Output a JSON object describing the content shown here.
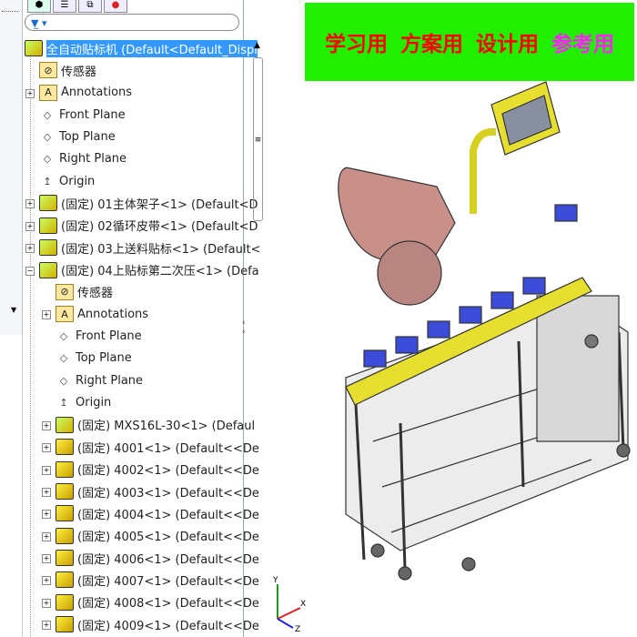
{
  "tabs": [
    "feature-manager",
    "property-manager",
    "configuration-manager",
    "display-manager"
  ],
  "filter": {
    "icon": "funnel-icon ▾"
  },
  "tree": {
    "root": "全自动贴标机 (Default<Default_Displ",
    "items": [
      {
        "label": "传感器",
        "icon": "sensor-folder",
        "level": 1
      },
      {
        "label": "Annotations",
        "icon": "annotations",
        "level": 1,
        "expand": "+"
      },
      {
        "label": "Front Plane",
        "icon": "plane",
        "level": 1
      },
      {
        "label": "Top Plane",
        "icon": "plane",
        "level": 1
      },
      {
        "label": "Right Plane",
        "icon": "plane",
        "level": 1
      },
      {
        "label": "Origin",
        "icon": "origin",
        "level": 1
      },
      {
        "label": "(固定) 01主体架子<1> (Default<D",
        "icon": "asm",
        "level": 1,
        "expand": "+"
      },
      {
        "label": "(固定) 02循环皮带<1> (Default<D",
        "icon": "asm",
        "level": 1,
        "expand": "+"
      },
      {
        "label": "(固定) 03上送料贴标<1> (Default<",
        "icon": "asm",
        "level": 1,
        "expand": "+"
      },
      {
        "label": "(固定) 04上贴标第二次压<1> (Defa",
        "icon": "asm",
        "level": 1,
        "expand": "−"
      },
      {
        "label": "传感器",
        "icon": "sensor-folder",
        "level": 2
      },
      {
        "label": "Annotations",
        "icon": "annotations",
        "level": 2,
        "expand": "+"
      },
      {
        "label": "Front Plane",
        "icon": "plane",
        "level": 2
      },
      {
        "label": "Top Plane",
        "icon": "plane",
        "level": 2
      },
      {
        "label": "Right Plane",
        "icon": "plane",
        "level": 2
      },
      {
        "label": "Origin",
        "icon": "origin",
        "level": 2
      },
      {
        "label": "(固定) MXS16L-30<1> (Defaul",
        "icon": "asm",
        "level": 2,
        "expand": "+"
      },
      {
        "label": "(固定) 4001<1> (Default<<De",
        "icon": "part",
        "level": 2,
        "expand": "+"
      },
      {
        "label": "(固定) 4002<1> (Default<<De",
        "icon": "part",
        "level": 2,
        "expand": "+"
      },
      {
        "label": "(固定) 4003<1> (Default<<De",
        "icon": "part",
        "level": 2,
        "expand": "+"
      },
      {
        "label": "(固定) 4004<1> (Default<<De",
        "icon": "part",
        "level": 2,
        "expand": "+"
      },
      {
        "label": "(固定) 4005<1> (Default<<De",
        "icon": "part",
        "level": 2,
        "expand": "+"
      },
      {
        "label": "(固定) 4006<1> (Default<<De",
        "icon": "part",
        "level": 2,
        "expand": "+"
      },
      {
        "label": "(固定) 4007<1> (Default<<De",
        "icon": "part",
        "level": 2,
        "expand": "+"
      },
      {
        "label": "(固定) 4008<1> (Default<<De",
        "icon": "part",
        "level": 2,
        "expand": "+"
      },
      {
        "label": "(固定) 4009<1> (Default<<De",
        "icon": "part",
        "level": 2,
        "expand": "+"
      }
    ]
  },
  "banner": {
    "items": [
      "学习用",
      "方案用",
      "设计用",
      "参考用"
    ],
    "colors": [
      "#ff0000",
      "#ff0000",
      "#ff0000",
      "#ff22ff"
    ],
    "bg": "#22ee00"
  },
  "triad": {
    "x": "X",
    "y": "Y",
    "z": "Z"
  }
}
